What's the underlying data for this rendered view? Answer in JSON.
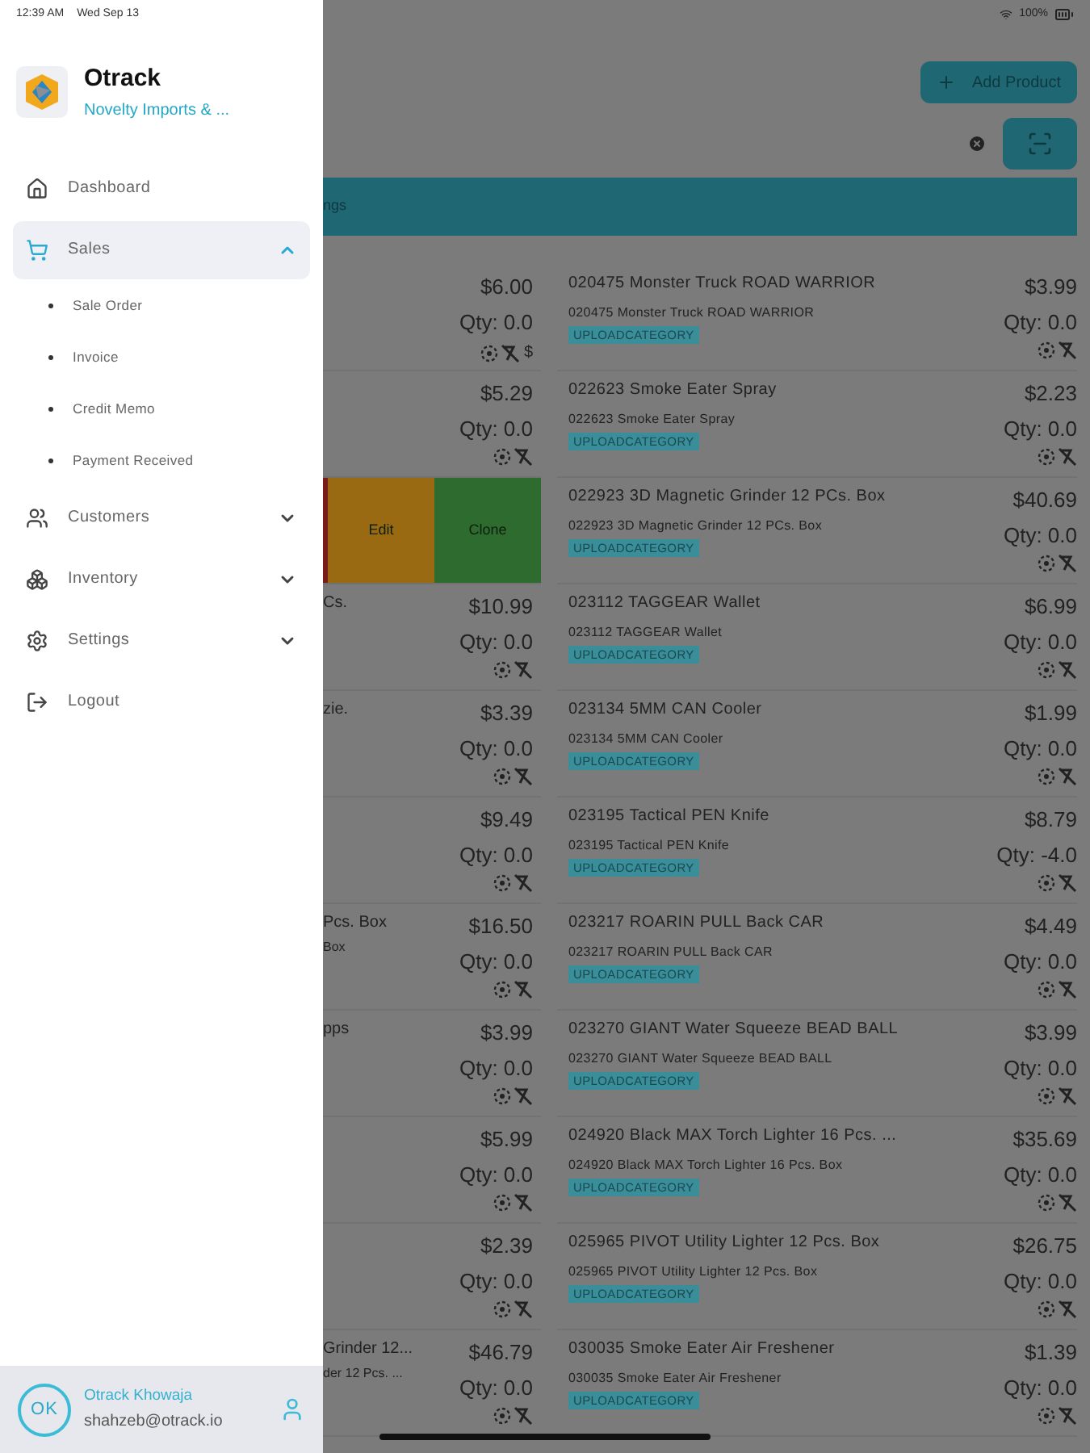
{
  "status_bar": {
    "time": "12:39 AM",
    "date": "Wed Sep 13",
    "battery": "100%"
  },
  "drawer": {
    "app_name": "Otrack",
    "company": "Novelty Imports & ...",
    "menu": [
      {
        "label": "Dashboard",
        "kind": "link",
        "selected": false
      },
      {
        "label": "Sales",
        "kind": "group",
        "expanded": true,
        "selected": true,
        "children": [
          {
            "label": "Sale Order"
          },
          {
            "label": "Invoice"
          },
          {
            "label": "Credit Memo"
          },
          {
            "label": "Payment Received"
          }
        ]
      },
      {
        "label": "Customers",
        "kind": "group",
        "expanded": false,
        "selected": false
      },
      {
        "label": "Inventory",
        "kind": "group",
        "expanded": false,
        "selected": false
      },
      {
        "label": "Settings",
        "kind": "group",
        "expanded": false,
        "selected": false
      },
      {
        "label": "Logout",
        "kind": "link",
        "selected": false
      }
    ],
    "user": {
      "initials": "OK",
      "name": "Otrack Khowaja",
      "email": "shahzeb@otrack.io"
    }
  },
  "main": {
    "add_button": "Add Product",
    "tab_label": "ngs",
    "left_rows": [
      {
        "kind": "item",
        "price": "$6.00",
        "qty": "Qty: 0.0",
        "suffix": "$"
      },
      {
        "kind": "item",
        "price": "$5.29",
        "qty": "Qty: 0.0"
      },
      {
        "kind": "swiped",
        "actions": [
          {
            "label": "Edit",
            "color": "#9a6a12"
          },
          {
            "label": "Clone",
            "color": "#2e6b2e"
          }
        ]
      },
      {
        "kind": "item",
        "title": "Cs.",
        "price": "$10.99",
        "qty": "Qty: 0.0"
      },
      {
        "kind": "item",
        "title": "zie.",
        "price": "$3.39",
        "qty": "Qty: 0.0"
      },
      {
        "kind": "item",
        "price": "$9.49",
        "qty": "Qty: 0.0"
      },
      {
        "kind": "item",
        "title": "Pcs. Box",
        "subtitle": "Box",
        "price": "$16.50",
        "qty": "Qty: 0.0"
      },
      {
        "kind": "item",
        "title": "pps",
        "price": "$3.99",
        "qty": "Qty: 0.0"
      },
      {
        "kind": "item",
        "price": "$5.99",
        "qty": "Qty: 0.0"
      },
      {
        "kind": "item",
        "price": "$2.39",
        "qty": "Qty: 0.0"
      },
      {
        "kind": "item",
        "title": "Grinder 12...",
        "subtitle": "der 12 Pcs. ...",
        "price": "$46.79",
        "qty": "Qty: 0.0"
      }
    ],
    "right_rows": [
      {
        "name": "020475 Monster Truck ROAD WARRIOR",
        "sub": "020475 Monster Truck ROAD WARRIOR",
        "tag": "UPLOADCATEGORY",
        "price": "$3.99",
        "qty": "Qty: 0.0"
      },
      {
        "name": "022623 Smoke Eater Spray",
        "sub": "022623 Smoke Eater Spray",
        "tag": "UPLOADCATEGORY",
        "price": "$2.23",
        "qty": "Qty: 0.0"
      },
      {
        "name": "022923 3D Magnetic Grinder 12 PCs. Box",
        "sub": "022923 3D Magnetic Grinder 12 PCs. Box",
        "tag": "UPLOADCATEGORY",
        "price": "$40.69",
        "qty": "Qty: 0.0"
      },
      {
        "name": "023112 TAGGEAR Wallet",
        "sub": "023112 TAGGEAR Wallet",
        "tag": "UPLOADCATEGORY",
        "price": "$6.99",
        "qty": "Qty: 0.0"
      },
      {
        "name": "023134 5MM CAN Cooler",
        "sub": "023134 5MM CAN Cooler",
        "tag": "UPLOADCATEGORY",
        "price": "$1.99",
        "qty": "Qty: 0.0"
      },
      {
        "name": "023195 Tactical PEN Knife",
        "sub": "023195 Tactical PEN Knife",
        "tag": "UPLOADCATEGORY",
        "price": "$8.79",
        "qty": "Qty: -4.0"
      },
      {
        "name": "023217 ROARIN PULL Back CAR",
        "sub": "023217 ROARIN PULL Back CAR",
        "tag": "UPLOADCATEGORY",
        "price": "$4.49",
        "qty": "Qty: 0.0"
      },
      {
        "name": "023270 GIANT Water Squeeze BEAD BALL",
        "sub": "023270 GIANT Water Squeeze BEAD BALL",
        "tag": "UPLOADCATEGORY",
        "price": "$3.99",
        "qty": "Qty: 0.0"
      },
      {
        "name": "024920 Black MAX Torch Lighter 16 Pcs. ...",
        "sub": "024920 Black MAX Torch Lighter 16 Pcs. Box",
        "tag": "UPLOADCATEGORY",
        "price": "$35.69",
        "qty": "Qty: 0.0"
      },
      {
        "name": "025965 PIVOT Utility Lighter 12 Pcs. Box",
        "sub": "025965 PIVOT Utility Lighter 12 Pcs. Box",
        "tag": "UPLOADCATEGORY",
        "price": "$26.75",
        "qty": "Qty: 0.0"
      },
      {
        "name": "030035 Smoke Eater Air Freshener",
        "sub": "030035 Smoke Eater Air Freshener",
        "tag": "UPLOADCATEGORY",
        "price": "$1.39",
        "qty": "Qty: 0.0"
      }
    ]
  }
}
